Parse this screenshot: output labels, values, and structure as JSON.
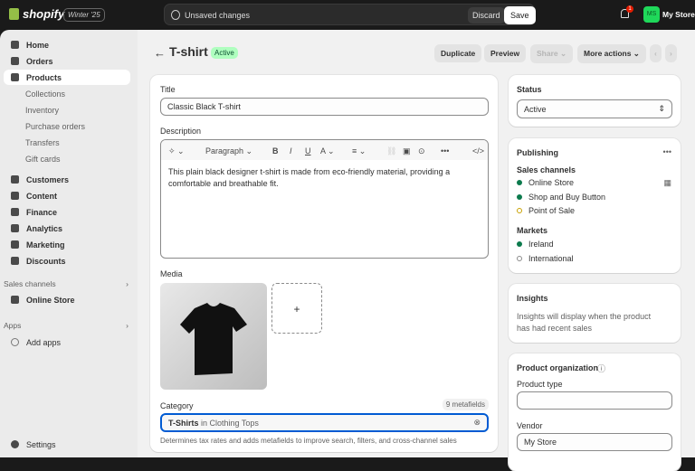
{
  "topbar": {
    "brand": "shopify",
    "edition": "Winter '25",
    "unsaved": "Unsaved changes",
    "discard": "Discard",
    "save": "Save",
    "notifications": "1",
    "avatar": "MS",
    "store": "My Store"
  },
  "sidebar": {
    "items": [
      "Home",
      "Orders",
      "Products",
      "Collections",
      "Inventory",
      "Purchase orders",
      "Transfers",
      "Gift cards",
      "Customers",
      "Content",
      "Finance",
      "Analytics",
      "Marketing",
      "Discounts"
    ],
    "sales_channels": "Sales channels",
    "online_store": "Online Store",
    "apps": "Apps",
    "add_apps": "Add apps",
    "settings": "Settings"
  },
  "header": {
    "back": "←",
    "title": "T-shirt",
    "status": "Active",
    "duplicate": "Duplicate",
    "preview": "Preview",
    "share": "Share ⌄",
    "more": "More actions ⌄",
    "prev": "‹",
    "next": "›"
  },
  "product": {
    "title_label": "Title",
    "title_value": "Classic Black T-shirt",
    "description_label": "Description",
    "toolbar": {
      "paragraph": "Paragraph ⌄",
      "bold": "B",
      "italic": "I",
      "underline": "U",
      "color": "A ⌄",
      "align": "≡ ⌄",
      "more": "•••",
      "code": "</>",
      "magic": "✧ ⌄"
    },
    "description": "This plain black designer t-shirt is made from eco-friendly material, providing a comfortable and breathable fit.",
    "media_label": "Media",
    "add_media": "+",
    "category_label": "Category",
    "metafields": "9 metafields",
    "category_value": "T-Shirts",
    "category_parent": " in Clothing Tops",
    "category_help": "Determines tax rates and adds metafields to improve search, filters, and cross-channel sales"
  },
  "status_card": {
    "title": "Status",
    "value": "Active"
  },
  "publishing": {
    "title": "Publishing",
    "menu": "•••",
    "sales_channels": "Sales channels",
    "channels": [
      "Online Store",
      "Shop and Buy Button",
      "Point of Sale"
    ],
    "markets_label": "Markets",
    "markets": [
      "Ireland",
      "International"
    ]
  },
  "insights": {
    "title": "Insights",
    "text": "Insights will display when the product has had recent sales"
  },
  "organization": {
    "title": "Product organization",
    "type_label": "Product type",
    "type_value": "",
    "vendor_label": "Vendor",
    "vendor_value": "My Store"
  },
  "colors": {
    "active_bg": "#affebf",
    "accent_green": "#0c7a4d",
    "focus": "#005bd3"
  }
}
